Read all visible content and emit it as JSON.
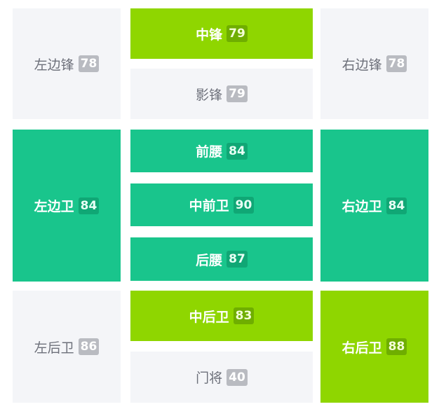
{
  "colors": {
    "lime": "#8fd600",
    "teal": "#19c58c",
    "gray": "#f4f5f8"
  },
  "positions": [
    {
      "label": "左边锋",
      "rating": "78",
      "style": "gray"
    },
    {
      "label": "中锋",
      "rating": "79",
      "style": "lime"
    },
    {
      "label": "影锋",
      "rating": "79",
      "style": "gray"
    },
    {
      "label": "右边锋",
      "rating": "78",
      "style": "gray"
    },
    {
      "label": "左边卫",
      "rating": "84",
      "style": "teal"
    },
    {
      "label": "前腰",
      "rating": "84",
      "style": "teal"
    },
    {
      "label": "中前卫",
      "rating": "90",
      "style": "teal"
    },
    {
      "label": "后腰",
      "rating": "87",
      "style": "teal"
    },
    {
      "label": "右边卫",
      "rating": "84",
      "style": "teal"
    },
    {
      "label": "左后卫",
      "rating": "86",
      "style": "gray"
    },
    {
      "label": "中后卫",
      "rating": "83",
      "style": "lime"
    },
    {
      "label": "门将",
      "rating": "40",
      "style": "gray"
    },
    {
      "label": "右后卫",
      "rating": "88",
      "style": "lime"
    }
  ]
}
